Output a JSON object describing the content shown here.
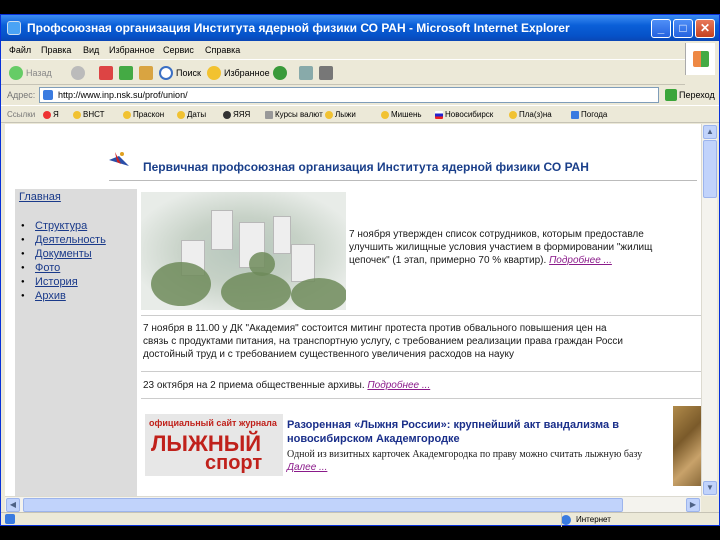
{
  "window": {
    "title": "Профсоюзная организация Института ядерной физики СО РАН - Microsoft Internet Explorer",
    "minimize": "_",
    "maximize": "□",
    "close": "✕"
  },
  "menu": [
    "Файл",
    "Правка",
    "Вид",
    "Избранное",
    "Сервис",
    "Справка"
  ],
  "toolbar": {
    "back": "Назад",
    "search": "Поиск",
    "favorites": "Избранное"
  },
  "address": {
    "label": "Адрес:",
    "url": "http://www.inp.nsk.su/prof/union/",
    "go": "Переход"
  },
  "links": {
    "label": "Ссылки",
    "items": [
      "Я",
      "ВНСТ",
      "Праскон",
      "Даты",
      "ЯЯЯ",
      "Курсы валют",
      "Лыжи",
      "Мишень",
      "Новосибирск",
      "Пла(з)на",
      "Погода"
    ]
  },
  "page": {
    "title": "Первичная профсоюзная организация Института ядерной физики СО РАН",
    "nav_home": "Главная",
    "nav": [
      "Структура",
      "Деятельность",
      "Документы",
      "Фото",
      "История",
      "Архив"
    ],
    "news1": {
      "lines": [
        "7 ноября утвержден список сотрудников, которым предоставле",
        "улучшить жилищные условия участием в формировании \"жилищ",
        "цепочек\" (1 этап, примерно 70 % квартир)."
      ],
      "more": "Подробнее ..."
    },
    "news2": {
      "lines": [
        "7 ноября в 11.00 у ДК \"Академия\" состоится митинг протеста против обвального повышения цен на",
        "связь с продуктами питания, на транспортную услугу, с требованием реализации права граждан Росси",
        "достойный труд и с требованием существенного увеличения расходов на науку"
      ]
    },
    "news3": {
      "text": "23 октября на 2 приема общественные архивы.",
      "more": "Подробнее ..."
    },
    "ad": {
      "small": "официальный сайт журнала",
      "big1": "ЛЫЖНЫЙ",
      "big2": "спорт"
    },
    "article": {
      "title": "Разоренная «Лыжня России»: крупнейший акт вандализма в новосибирском Академгородке",
      "body": "Одной из визитных карточек Академгородка по праву можно считать лыжную базу",
      "more": "Далее ..."
    }
  },
  "status": {
    "zone": "Интернет"
  }
}
